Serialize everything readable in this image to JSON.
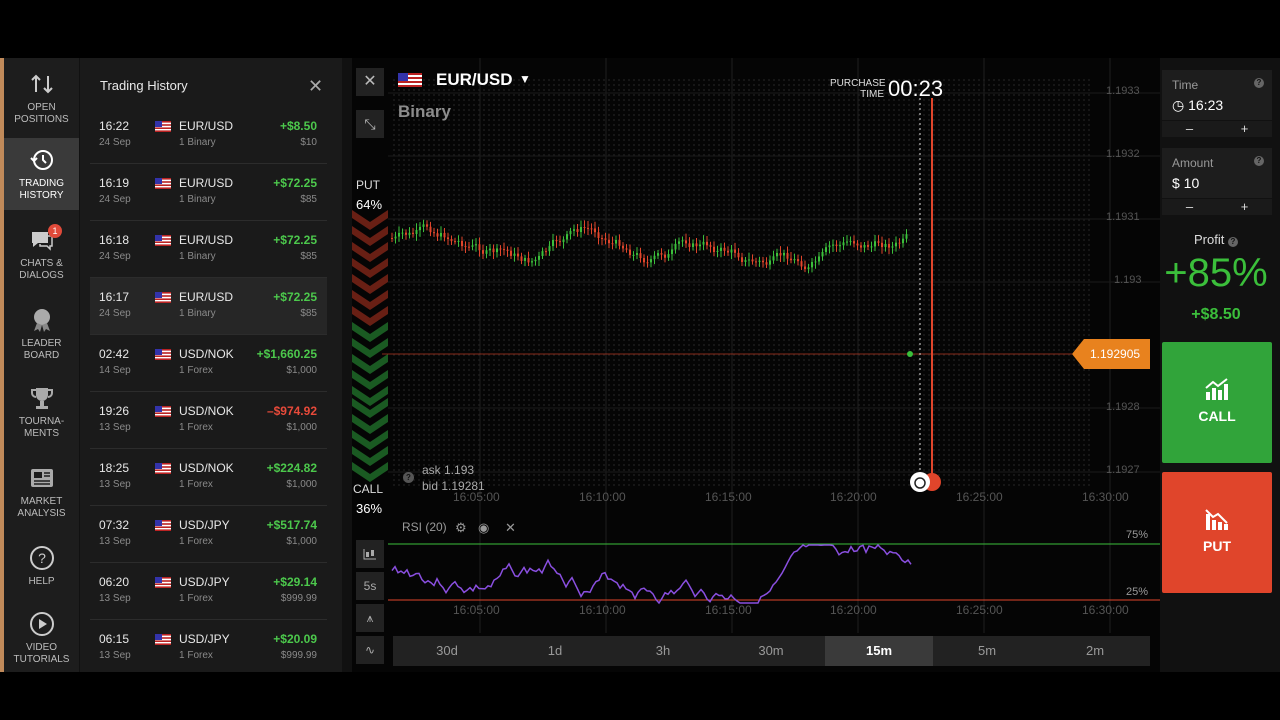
{
  "sidebar": {
    "items": [
      {
        "label": "OPEN POSITIONS",
        "icon": "open-positions-icon"
      },
      {
        "label": "TRADING HISTORY",
        "icon": "history-icon"
      },
      {
        "label": "CHATS & DIALOGS",
        "icon": "chat-icon",
        "badge": "1"
      },
      {
        "label": "LEADER BOARD",
        "icon": "leaderboard-icon"
      },
      {
        "label": "TOURNA- MENTS",
        "icon": "trophy-icon"
      },
      {
        "label": "MARKET ANALYSIS",
        "icon": "newspaper-icon"
      },
      {
        "label": "HELP",
        "icon": "help-icon"
      },
      {
        "label": "VIDEO TUTORIALS",
        "icon": "play-icon"
      }
    ]
  },
  "history": {
    "title": "Trading History",
    "close": "✕",
    "rows": [
      {
        "time": "16:22",
        "date": "24 Sep",
        "pair": "EUR/USD",
        "type": "1 Binary",
        "pnl": "+$8.50",
        "amount": "$10",
        "flag": "us"
      },
      {
        "time": "16:19",
        "date": "24 Sep",
        "pair": "EUR/USD",
        "type": "1 Binary",
        "pnl": "+$72.25",
        "amount": "$85",
        "flag": "us"
      },
      {
        "time": "16:18",
        "date": "24 Sep",
        "pair": "EUR/USD",
        "type": "1 Binary",
        "pnl": "+$72.25",
        "amount": "$85",
        "flag": "us"
      },
      {
        "time": "16:17",
        "date": "24 Sep",
        "pair": "EUR/USD",
        "type": "1 Binary",
        "pnl": "+$72.25",
        "amount": "$85",
        "flag": "us"
      },
      {
        "time": "02:42",
        "date": "14 Sep",
        "pair": "USD/NOK",
        "type": "1 Forex",
        "pnl": "+$1,660.25",
        "amount": "$1,000",
        "flag": "us"
      },
      {
        "time": "19:26",
        "date": "13 Sep",
        "pair": "USD/NOK",
        "type": "1 Forex",
        "pnl": "–$974.92",
        "amount": "$1,000",
        "flag": "us"
      },
      {
        "time": "18:25",
        "date": "13 Sep",
        "pair": "USD/NOK",
        "type": "1 Forex",
        "pnl": "+$224.82",
        "amount": "$1,000",
        "flag": "us"
      },
      {
        "time": "07:32",
        "date": "13 Sep",
        "pair": "USD/JPY",
        "type": "1 Forex",
        "pnl": "+$517.74",
        "amount": "$1,000",
        "flag": "us"
      },
      {
        "time": "06:20",
        "date": "13 Sep",
        "pair": "USD/JPY",
        "type": "1 Forex",
        "pnl": "+$29.14",
        "amount": "$999.99",
        "flag": "us"
      },
      {
        "time": "06:15",
        "date": "13 Sep",
        "pair": "USD/JPY",
        "type": "1 Forex",
        "pnl": "+$20.09",
        "amount": "$999.99",
        "flag": "us"
      }
    ]
  },
  "chart": {
    "close": "✕",
    "collapse": "⤡",
    "asset": "EUR/USD",
    "asset_type": "Binary",
    "purchase_label": "PURCHASE TIME",
    "purchase_time": "00:23",
    "put_label": "PUT",
    "put_pct": "64%",
    "call_label": "CALL",
    "call_pct": "36%",
    "ask": "ask 1.193",
    "bid": "bid 1.19281",
    "askbid_icon": "?",
    "current_price": "1.192905",
    "x_ticks": [
      "16:05:00",
      "16:10:00",
      "16:15:00",
      "16:20:00",
      "16:25:00",
      "16:30:00"
    ],
    "y_ticks": [
      "1.1933",
      "1.1932",
      "1.1931",
      "1.193",
      "1.1928",
      "1.1927"
    ],
    "rsi_title": "RSI (20)",
    "rsi_75": "75%",
    "rsi_25": "25%",
    "tool_period": "5s",
    "timeframes": [
      "30d",
      "1d",
      "3h",
      "30m",
      "15m",
      "5m",
      "2m"
    ],
    "active_timeframe": "15m"
  },
  "right": {
    "time_label": "Time",
    "time_value": "16:23",
    "amount_label": "Amount",
    "amount_value": "$ 10",
    "minus": "–",
    "plus": "+",
    "help": "?",
    "profit_label": "Profit",
    "profit_pct": "+85%",
    "profit_amount": "+$8.50",
    "call_label": "CALL",
    "put_label": "PUT"
  },
  "colors": {
    "up": "#3bbf3b",
    "down": "#e0452b",
    "rsi": "#8a4fe0",
    "price_tag": "#e8821e"
  }
}
